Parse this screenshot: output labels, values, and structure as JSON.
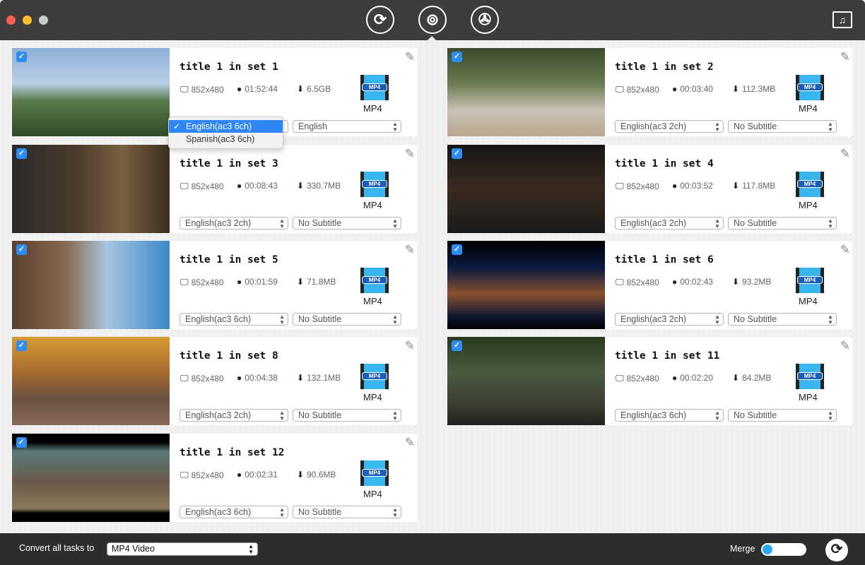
{
  "toolbar": {
    "tabs": [
      {
        "name": "convert-tab-icon",
        "glyph": "⟳"
      },
      {
        "name": "rip-disc-tab-icon",
        "glyph": "⊚"
      },
      {
        "name": "download-tab-icon",
        "glyph": "✇"
      }
    ],
    "right_icon": "media-library-icon"
  },
  "colors": {
    "accent": "#2e8df5",
    "titlebar": "#3d3d3d",
    "bottombar": "#2d2d2d"
  },
  "tasks": [
    {
      "title": "title 1 in set 1",
      "resolution": "852x480",
      "duration": "01:52:44",
      "size": "6.5GB",
      "format": "MP4",
      "audio": "English(ac3 6ch)",
      "subtitle": "English",
      "checked": true,
      "thumb": "linear-gradient(180deg,#8fb0d8 0%,#b8cfe6 40%,#5a7a4a 60%,#2f4a26 100%)"
    },
    {
      "title": "title 1 in set 2",
      "resolution": "852x480",
      "duration": "00:03:40",
      "size": "112.3MB",
      "format": "MP4",
      "audio": "English(ac3 2ch)",
      "subtitle": "No Subtitle",
      "checked": true,
      "thumb": "linear-gradient(180deg,#3c4a2a 0%,#6a7a50 40%,#c9c2b5 70%,#b9a890 100%)"
    },
    {
      "title": "title 1 in set 3",
      "resolution": "852x480",
      "duration": "00:08:43",
      "size": "330.7MB",
      "format": "MP4",
      "audio": "English(ac3 2ch)",
      "subtitle": "No Subtitle",
      "checked": true,
      "thumb": "linear-gradient(90deg,#2a2a2a 0%,#4a3a2a 40%,#7a6040 70%,#3a3020 100%)"
    },
    {
      "title": "title 1 in set 4",
      "resolution": "852x480",
      "duration": "00:03:52",
      "size": "117.8MB",
      "format": "MP4",
      "audio": "English(ac3 2ch)",
      "subtitle": "No Subtitle",
      "checked": true,
      "thumb": "linear-gradient(180deg,#151515 0%,#3a2a20 50%,#1a1a1a 100%)"
    },
    {
      "title": "title 1 in set 5",
      "resolution": "852x480",
      "duration": "00:01:59",
      "size": "71.8MB",
      "format": "MP4",
      "audio": "English(ac3 6ch)",
      "subtitle": "No Subtitle",
      "checked": true,
      "thumb": "linear-gradient(90deg,#5a4030 0%,#8a6a50 35%,#a8c4e0 60%,#3a8ac8 100%)"
    },
    {
      "title": "title 1 in set 6",
      "resolution": "852x480",
      "duration": "00:02:43",
      "size": "93.2MB",
      "format": "MP4",
      "audio": "English(ac3 2ch)",
      "subtitle": "No Subtitle",
      "checked": true,
      "thumb": "linear-gradient(180deg,#000 0%,#0a1a40 30%,#8a5030 60%,#101830 85%,#000 100%)"
    },
    {
      "title": "title 1 in set 8",
      "resolution": "852x480",
      "duration": "00:04:38",
      "size": "132.1MB",
      "format": "MP4",
      "audio": "English(ac3 2ch)",
      "subtitle": "No Subtitle",
      "checked": true,
      "thumb": "linear-gradient(180deg,#d89a30 0%,#a86a30 40%,#6a5040 70%,#8a6a5a 100%)"
    },
    {
      "title": "title 1 in set 11",
      "resolution": "852x480",
      "duration": "00:02:20",
      "size": "84.2MB",
      "format": "MP4",
      "audio": "English(ac3 6ch)",
      "subtitle": "No Subtitle",
      "checked": true,
      "thumb": "linear-gradient(180deg,#2a3a20 0%,#4a5a40 40%,#3a3a30 80%,#202020 100%)"
    },
    {
      "title": "title 1 in set 12",
      "resolution": "852x480",
      "duration": "00:02:31",
      "size": "90.6MB",
      "format": "MP4",
      "audio": "English(ac3 6ch)",
      "subtitle": "No Subtitle",
      "checked": true,
      "thumb": "linear-gradient(180deg,#000 0%,#000 10%,#5a7a7a 20%,#6a5a4a 55%,#8a7a5a 85%,#000 90%)"
    }
  ],
  "audio_dropdown": {
    "options": [
      "English(ac3 6ch)",
      "Spanish(ac3 6ch)"
    ],
    "selected": "English(ac3 6ch)"
  },
  "bottom": {
    "convert_label": "Convert all tasks to",
    "format": "MP4 Video",
    "merge_label": "Merge",
    "merge_on": false
  }
}
